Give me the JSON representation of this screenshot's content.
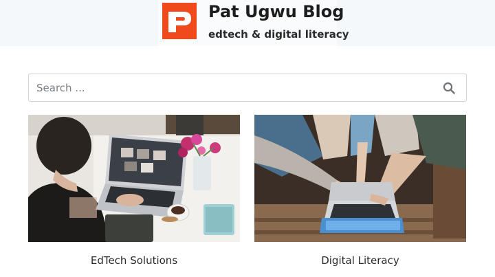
{
  "site": {
    "title": "Pat Ugwu Blog",
    "tagline": "edtech & digital literacy",
    "logo_icon": "letter-p-logo",
    "brand_color": "#f04a1c"
  },
  "search": {
    "placeholder": "Search ...",
    "value": "",
    "icon": "search-icon"
  },
  "cards": [
    {
      "label": "EdTech Solutions",
      "image": "woman-at-laptop-with-flowers-photo"
    },
    {
      "label": "Digital Literacy",
      "image": "hands-pointing-at-laptop-photo"
    }
  ]
}
